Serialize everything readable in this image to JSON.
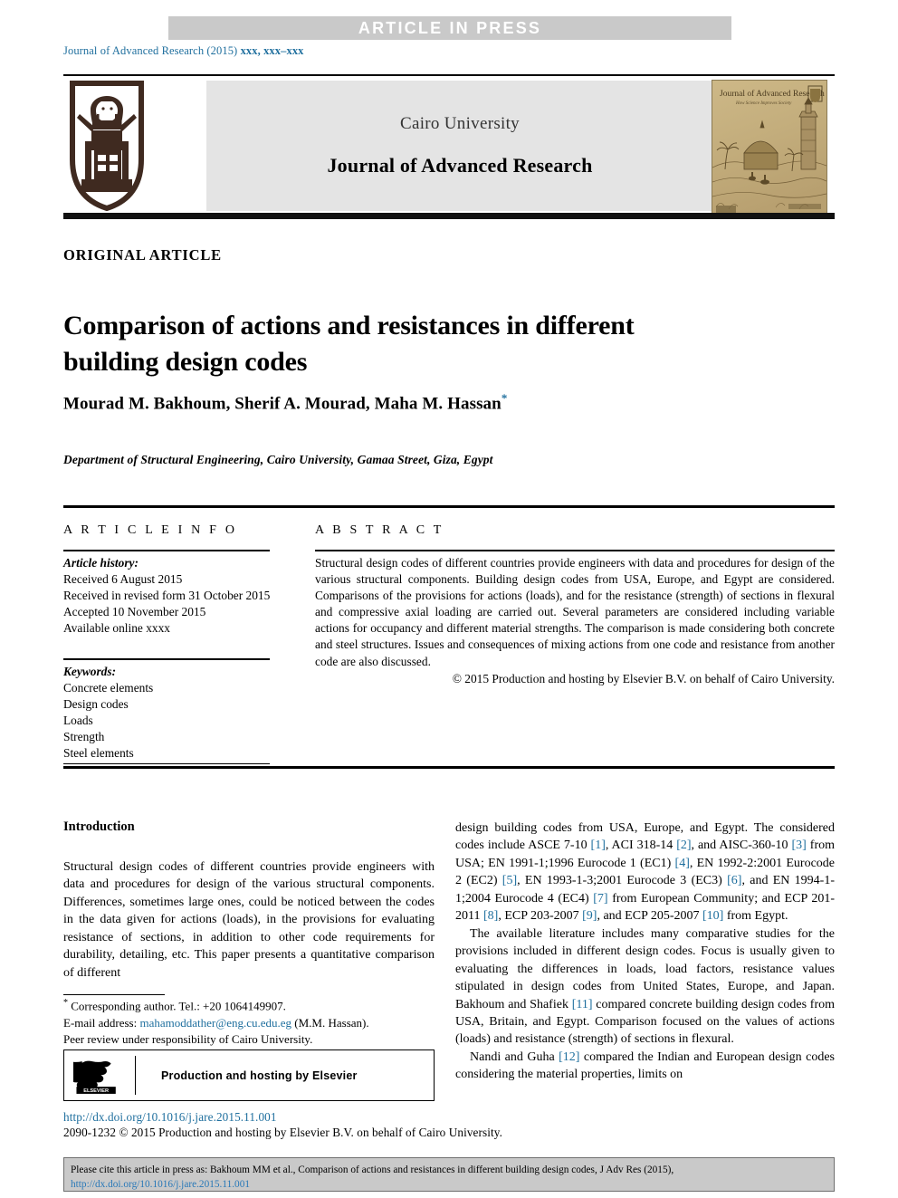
{
  "banner": {
    "text": "ARTICLE  IN  PRESS"
  },
  "journal_ref": {
    "prefix": "Journal of Advanced Research (2015) ",
    "volume": "xxx",
    "pages": ", xxx–xxx"
  },
  "masthead": {
    "university": "Cairo University",
    "journal_title": "Journal of Advanced Research",
    "cover_title": "Journal of Advanced Research",
    "cover_tagline": "How Science Improves Society",
    "logo_alt": "Cairo University shield logo"
  },
  "article": {
    "type_label": "ORIGINAL ARTICLE",
    "title": "Comparison of actions and resistances in different building design codes",
    "authors": "Mourad M. Bakhoum, Sherif A. Mourad, Maha M. Hassan",
    "author_marker": "*",
    "affiliation": "Department of Structural Engineering, Cairo University, Gamaa Street, Giza, Egypt"
  },
  "info": {
    "heading": "A R T I C L E   I N F O",
    "history_label": "Article history:",
    "history": [
      "Received 6 August 2015",
      "Received in revised form 31 October 2015",
      "Accepted 10 November 2015",
      "Available online xxxx"
    ],
    "keywords_label": "Keywords:",
    "keywords": [
      "Concrete elements",
      "Design codes",
      "Loads",
      "Strength",
      "Steel elements"
    ]
  },
  "abstract": {
    "heading": "A B S T R A C T",
    "text": "Structural design codes of different countries provide engineers with data and procedures for design of the various structural components. Building design codes from USA, Europe, and Egypt are considered. Comparisons of the provisions for actions (loads), and for the resistance (strength) of sections in flexural and compressive axial loading are carried out. Several parameters are considered including variable actions for occupancy and different material strengths. The comparison is made considering both concrete and steel structures. Issues and consequences of mixing actions from one code and resistance from another code are also discussed.",
    "copyright": "© 2015 Production and hosting by Elsevier B.V. on behalf of Cairo University."
  },
  "body": {
    "section_heading": "Introduction",
    "left_paragraph": "Structural design codes of different countries provide engineers with data and procedures for design of the various structural components. Differences, sometimes large ones, could be noticed between the codes in the data given for actions (loads), in the provisions for evaluating resistance of sections, in addition to other code requirements for durability, detailing, etc. This paper presents a quantitative comparison of different",
    "right_paragraph_1_part1": "design building codes from USA, Europe, and Egypt. The considered codes include ASCE 7-10 ",
    "right_paragraph_1_ref1": "[1]",
    "right_paragraph_1_part2": ", ACI 318-14 ",
    "right_paragraph_1_ref2": "[2]",
    "right_paragraph_1_part3": ", and AISC-360-10 ",
    "right_paragraph_1_ref3": "[3]",
    "right_paragraph_1_part4": " from USA; EN 1991-1;1996 Eurocode 1 (EC1) ",
    "right_paragraph_1_ref4": "[4]",
    "right_paragraph_1_part5": ", EN 1992-2:2001 Eurocode 2 (EC2) ",
    "right_paragraph_1_ref5": "[5]",
    "right_paragraph_1_part6": ", EN 1993-1-3;2001 Eurocode 3 (EC3) ",
    "right_paragraph_1_ref6": "[6]",
    "right_paragraph_1_part7": ", and EN 1994-1-1;2004 Eurocode 4 (EC4) ",
    "right_paragraph_1_ref7": "[7]",
    "right_paragraph_1_part8": " from European Community; and ECP 201-2011 ",
    "right_paragraph_1_ref8": "[8]",
    "right_paragraph_1_part9": ", ECP 203-2007 ",
    "right_paragraph_1_ref9": "[9]",
    "right_paragraph_1_part10": ", and ECP 205-2007 ",
    "right_paragraph_1_ref10": "[10]",
    "right_paragraph_1_part11": " from Egypt.",
    "right_paragraph_2_part1": "The available literature includes many comparative studies for the provisions included in different design codes. Focus is usually given to evaluating the differences in loads, load factors, resistance values stipulated in design codes from United States, Europe, and Japan. Bakhoum and Shafiek ",
    "right_paragraph_2_ref": "[11]",
    "right_paragraph_2_part2": " compared concrete building design codes from USA, Britain, and Egypt. Comparison focused on the values of actions (loads) and resistance (strength) of sections in flexural.",
    "right_paragraph_3_part1": "Nandi and Guha ",
    "right_paragraph_3_ref": "[12]",
    "right_paragraph_3_part2": " compared the Indian and European design codes considering the material properties, limits on"
  },
  "footnote": {
    "corresponding": "Corresponding author. Tel.: +20 1064149907.",
    "email_label": "E-mail address: ",
    "email": "mahamoddather@eng.cu.edu.eg",
    "email_suffix": " (M.M. Hassan).",
    "peer_review": "Peer review under responsibility of Cairo University."
  },
  "elsevier": {
    "wordmark": "ELSEVIER",
    "label": "Production and hosting by Elsevier"
  },
  "doi": {
    "url": "http://dx.doi.org/10.1016/j.jare.2015.11.001",
    "issn_line": "2090-1232 © 2015 Production and hosting by Elsevier B.V. on behalf of Cairo University."
  },
  "cite_footer": {
    "text": "Please cite this article in press as: Bakhoum MM et al., Comparison of actions and resistances in different building design codes, J Adv Res (2015), ",
    "link": "http://dx.doi.org/10.1016/j.jare.2015.11.001"
  },
  "colors": {
    "banner_bg": "#c9c9c9",
    "link_blue": "#1f6f9e",
    "panel_gray": "#e4e4e4",
    "logo_brown": "#3f2a20",
    "cover_tan": "#c9b484"
  }
}
